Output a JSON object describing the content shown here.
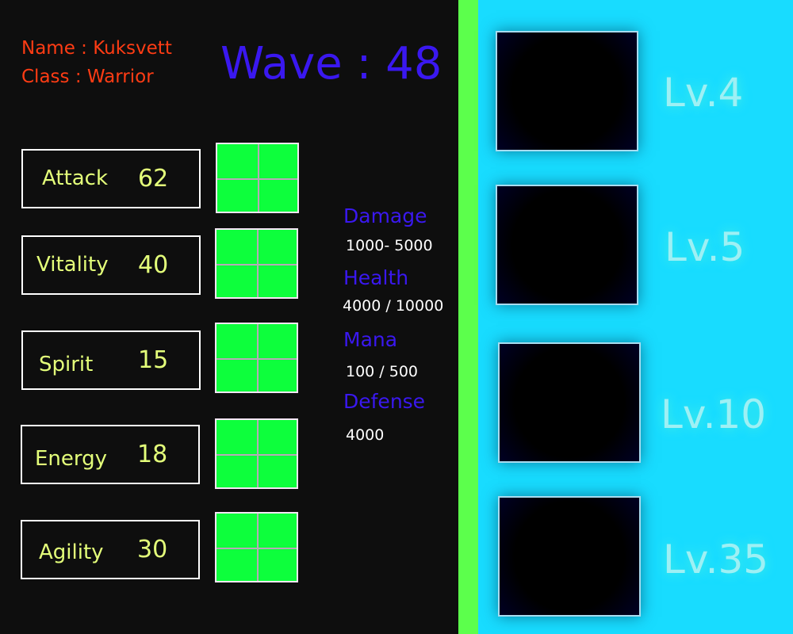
{
  "player": {
    "name": "Name : Kuksvett",
    "class": "Class : Warrior"
  },
  "wave": "Wave : 48",
  "stats": [
    {
      "label": "Attack",
      "value": "62"
    },
    {
      "label": "Vitality",
      "value": "40"
    },
    {
      "label": "Spirit",
      "value": "15"
    },
    {
      "label": "Energy",
      "value": "18"
    },
    {
      "label": "Agility",
      "value": "30"
    }
  ],
  "derived": [
    {
      "label": "Damage",
      "value": "1000- 5000"
    },
    {
      "label": "Health",
      "value": "4000 / 10000"
    },
    {
      "label": "Mana",
      "value": "100 / 500"
    },
    {
      "label": "Defense",
      "value": "4000"
    }
  ],
  "skills": [
    {
      "level": "Lv.4"
    },
    {
      "level": "Lv.5"
    },
    {
      "level": "Lv.10"
    },
    {
      "level": "Lv.35"
    }
  ],
  "colors": {
    "accent": "#3a18f0",
    "name": "#ff3c14",
    "stat": "#e4ff7a",
    "panel": "#18dcff",
    "divider": "#5cff4c",
    "slot_grid": "#0dff3c"
  }
}
